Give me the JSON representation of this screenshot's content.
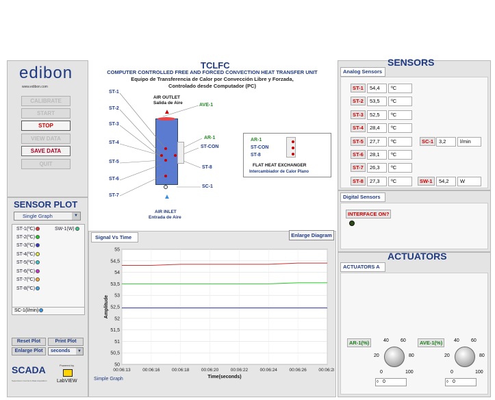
{
  "brand": {
    "name": "edibon",
    "url": "www.edibon.com",
    "scada": "SCADA",
    "scada_sub": "Supervision Control & Data Acquisition",
    "powered": "Powered by",
    "labview": "LabVIEW"
  },
  "controls": {
    "calibrate": "CALIBRATE",
    "start": "START",
    "stop": "STOP",
    "view_data": "VIEW DATA",
    "save_data": "SAVE DATA",
    "quit": "QUIT"
  },
  "diagram": {
    "code": "TCLFC",
    "title": "COMPUTER CONTROLLED FREE AND FORCED CONVECTION HEAT TRANSFER UNIT",
    "subtitle1": "Equipo de Transferencia de Calor por Convección Libre y Forzada,",
    "subtitle2": "Controlado desde Computador (PC)",
    "air_outlet": "AIR OUTLET",
    "salida": "Salida de Aire",
    "air_inlet": "AIR INLET",
    "entrada": "Entrada de Aire",
    "labels": {
      "st1": "ST-1",
      "st2": "ST-2",
      "st3": "ST-3",
      "st4": "ST-4",
      "st5": "ST-5",
      "st6": "ST-6",
      "st7": "ST-7",
      "ave1": "AVE-1",
      "ar1": "AR-1",
      "stcon": "ST-CON",
      "st8": "ST-8",
      "sc1": "SC-1"
    },
    "hx": {
      "ar1": "AR-1",
      "stcon": "ST-CON",
      "st8": "ST-8",
      "title": "FLAT HEAT EXCHANGER",
      "sub": "Intercambiador de Calor Plano"
    }
  },
  "sensors": {
    "title": "SENSORS",
    "analog_tab": "Analog Sensors",
    "rows": [
      {
        "name": "ST-1",
        "value": "54,4",
        "unit": "ºC"
      },
      {
        "name": "ST-2",
        "value": "53,5",
        "unit": "ºC"
      },
      {
        "name": "ST-3",
        "value": "52,5",
        "unit": "ºC"
      },
      {
        "name": "ST-4",
        "value": "28,4",
        "unit": "ºC"
      },
      {
        "name": "ST-5",
        "value": "27,7",
        "unit": "ºC"
      },
      {
        "name": "ST-6",
        "value": "28,1",
        "unit": "ºC"
      },
      {
        "name": "ST-7",
        "value": "26,3",
        "unit": "ºC"
      },
      {
        "name": "ST-8",
        "value": "27,3",
        "unit": "ºC"
      }
    ],
    "sc1": {
      "name": "SC-1",
      "value": "3,2",
      "unit": "l/min"
    },
    "sw1": {
      "name": "SW-1",
      "value": "54,2",
      "unit": "W"
    },
    "digital_tab": "Digital Sensors",
    "interface": "INTERFACE ON?"
  },
  "actuators": {
    "title": "ACTUATORS",
    "tab": "ACTUATORS A",
    "ar1": {
      "label": "AR-1(%)",
      "value": "0"
    },
    "ave1": {
      "label": "AVE-1(%)",
      "value": "0"
    },
    "ticks": {
      "t0": "0",
      "t20": "20",
      "t40": "40",
      "t60": "60",
      "t80": "80",
      "t100": "100"
    }
  },
  "sensor_plot": {
    "title": "SENSOR PLOT",
    "mode": "Single Graph",
    "items": [
      {
        "label": "ST-1(ºC)",
        "color": "#e33"
      },
      {
        "label": "ST-2(ºC)",
        "color": "#2c2"
      },
      {
        "label": "ST-3(ºC)",
        "color": "#33c"
      },
      {
        "label": "ST-4(ºC)",
        "color": "#ee3"
      },
      {
        "label": "ST-5(ºC)",
        "color": "#3cc"
      },
      {
        "label": "ST-6(ºC)",
        "color": "#c3c"
      },
      {
        "label": "ST-7(ºC)",
        "color": "#fa3"
      },
      {
        "label": "ST-8(ºC)",
        "color": "#3ae"
      }
    ],
    "sw1": {
      "label": "SW-1(W)",
      "color": "#3c8"
    },
    "sc1": {
      "label": "SC-1(l/min)",
      "color": "#39e"
    },
    "reset": "Reset Plot",
    "print": "Print Plot",
    "enlarge": "Enlarge Plot",
    "units": "seconds"
  },
  "graph": {
    "tab": "Signal Vs Time",
    "enlarge_diagram": "Enlarge Diagram",
    "footer": "Simple Graph"
  },
  "chart_data": {
    "type": "line",
    "xlabel": "Time(seconds)",
    "ylabel": "Amplitude",
    "ylim": [
      50,
      55
    ],
    "yticks": [
      "55",
      "54,5",
      "54",
      "53,5",
      "53",
      "52,5",
      "52",
      "51,5",
      "51",
      "50,5",
      "50"
    ],
    "xticks": [
      "00:06:13",
      "00:06:16",
      "00:06:18",
      "00:06:20",
      "00:06:22",
      "00:06:24",
      "00:06:26",
      "00:06:28"
    ],
    "series": [
      {
        "color": "#c33",
        "values": [
          54.3,
          54.3,
          54.35,
          54.35,
          54.35,
          54.35,
          54.4,
          54.4
        ]
      },
      {
        "color": "#3c3",
        "values": [
          53.5,
          53.5,
          53.5,
          53.5,
          53.5,
          53.5,
          53.55,
          53.55
        ]
      },
      {
        "color": "#339",
        "values": [
          52.45,
          52.45,
          52.45,
          52.45,
          52.45,
          52.45,
          52.45,
          52.45
        ]
      }
    ]
  }
}
